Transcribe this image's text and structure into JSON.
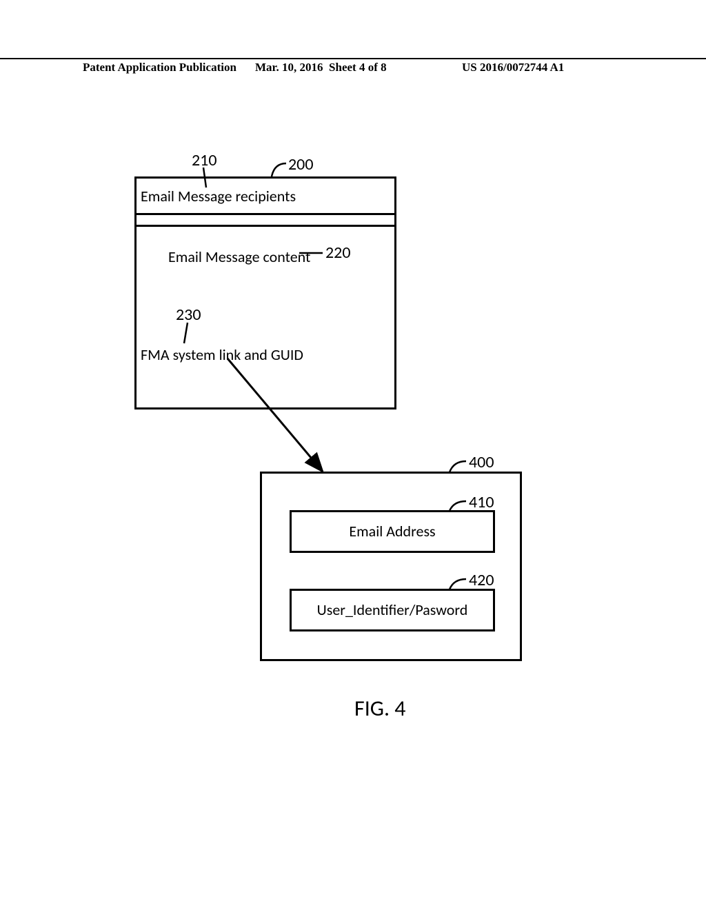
{
  "header": {
    "left": "Patent Application Publication",
    "date": "Mar. 10, 2016",
    "sheet": "Sheet 4 of 8",
    "pubno": "US 2016/0072744 A1"
  },
  "figure_label": "FIG. 4",
  "box200": {
    "recipients_label": "Email Message recipients",
    "content_label": "Email Message content",
    "fma_label": "FMA system link and GUID"
  },
  "box400": {
    "email_field_label": "Email Address",
    "userpass_field_label": "User_Identifier/Pasword"
  },
  "refs": {
    "r200": "200",
    "r210": "210",
    "r220": "220",
    "r230": "230",
    "r400": "400",
    "r410": "410",
    "r420": "420"
  }
}
